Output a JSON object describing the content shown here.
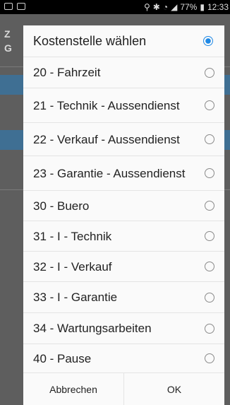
{
  "status_bar": {
    "battery": "77%",
    "time": "12:33"
  },
  "background": {
    "title_fragment": "Z",
    "subtitle_fragment": "G"
  },
  "dialog": {
    "title": "Kostenstelle wählen",
    "title_radio_selected": true,
    "options": [
      {
        "label": "20 - Fahrzeit",
        "selected": false
      },
      {
        "label": "21 - Technik - Aussendienst",
        "selected": false
      },
      {
        "label": "22 - Verkauf - Aussendienst",
        "selected": false
      },
      {
        "label": "23 - Garantie - Aussendienst",
        "selected": false
      },
      {
        "label": "30 - Buero",
        "selected": false
      },
      {
        "label": "31 - I  - Technik",
        "selected": false
      },
      {
        "label": "32 - I - Verkauf",
        "selected": false
      },
      {
        "label": "33 - I  -  Garantie",
        "selected": false
      },
      {
        "label": "34 - Wartungsarbeiten",
        "selected": false
      },
      {
        "label": "40 - Pause",
        "selected": false
      }
    ],
    "cancel_label": "Abbrechen",
    "ok_label": "OK"
  },
  "colors": {
    "accent": "#1e88e5",
    "dialog_bg": "#fafafa",
    "dim_bg": "#5e5e5e"
  }
}
